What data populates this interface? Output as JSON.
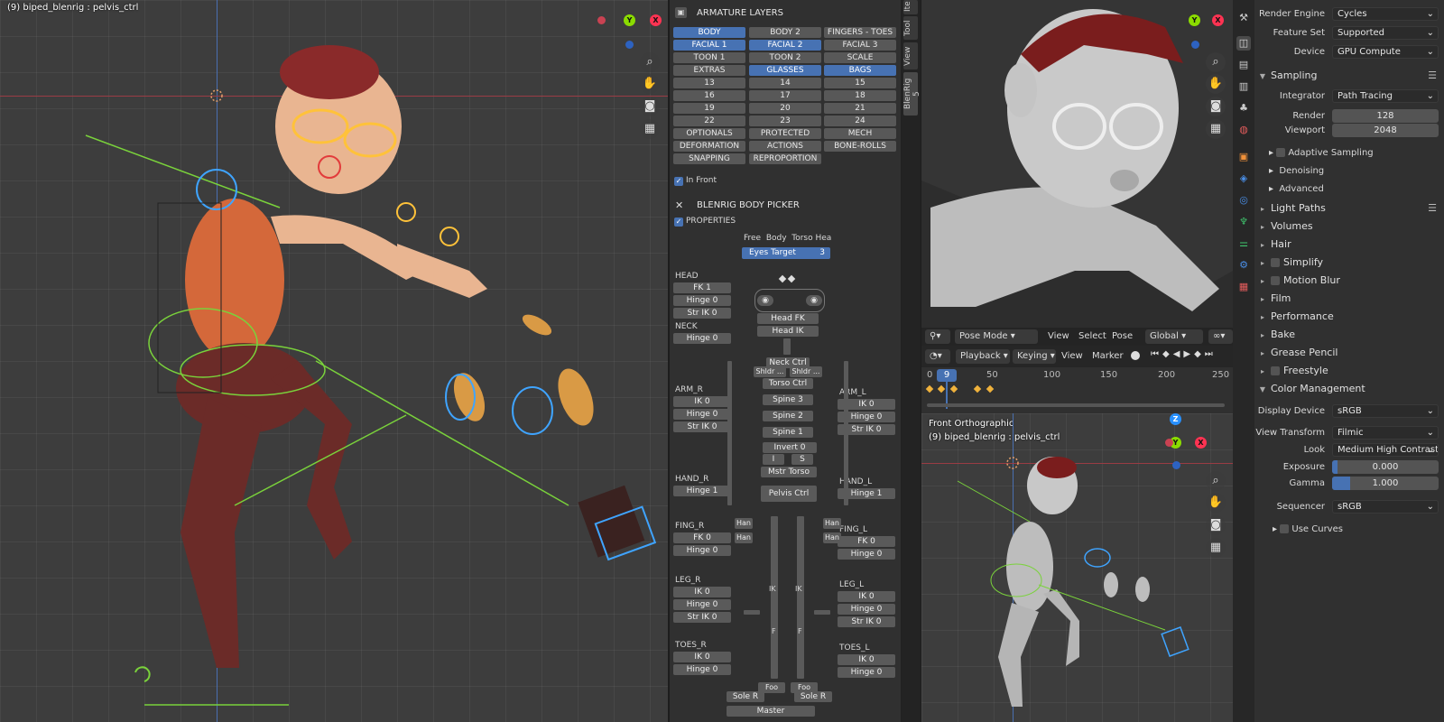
{
  "viewport_left": {
    "object_label": "(9) biped_blenrig : pelvis_ctrl",
    "axis": {
      "y": "Y",
      "x": "X"
    }
  },
  "armature_layers": {
    "title": "ARMATURE LAYERS",
    "rows": [
      [
        {
          "label": "BODY",
          "on": true
        },
        {
          "label": "BODY 2",
          "on": false
        },
        {
          "label": "FINGERS - TOES",
          "on": false
        }
      ],
      [
        {
          "label": "FACIAL 1",
          "on": true
        },
        {
          "label": "FACIAL 2",
          "on": true
        },
        {
          "label": "FACIAL 3",
          "on": false
        }
      ],
      [
        {
          "label": "TOON 1",
          "on": false
        },
        {
          "label": "TOON 2",
          "on": false
        },
        {
          "label": "SCALE",
          "on": false
        }
      ],
      [
        {
          "label": "EXTRAS",
          "on": false
        },
        {
          "label": "GLASSES",
          "on": true
        },
        {
          "label": "BAGS",
          "on": true
        }
      ],
      [
        {
          "label": "13",
          "on": false
        },
        {
          "label": "14",
          "on": false
        },
        {
          "label": "15",
          "on": false
        }
      ],
      [
        {
          "label": "16",
          "on": false
        },
        {
          "label": "17",
          "on": false
        },
        {
          "label": "18",
          "on": false
        }
      ],
      [
        {
          "label": "19",
          "on": false
        },
        {
          "label": "20",
          "on": false
        },
        {
          "label": "21",
          "on": false
        }
      ],
      [
        {
          "label": "22",
          "on": false
        },
        {
          "label": "23",
          "on": false
        },
        {
          "label": "24",
          "on": false
        }
      ],
      [
        {
          "label": "OPTIONALS",
          "on": false
        },
        {
          "label": "PROTECTED",
          "on": false
        },
        {
          "label": "MECH",
          "on": false
        }
      ],
      [
        {
          "label": "DEFORMATION",
          "on": false
        },
        {
          "label": "ACTIONS",
          "on": false
        },
        {
          "label": "BONE-ROLLS",
          "on": false
        }
      ],
      [
        {
          "label": "SNAPPING",
          "on": false
        },
        {
          "label": "REPROPORTION",
          "on": false
        }
      ]
    ],
    "in_front": "In Front"
  },
  "body_picker": {
    "title": "BLENRIG BODY PICKER",
    "properties": "PROPERTIES",
    "tabs": "Free  Body  Torso Hea",
    "eyes_target": "Eyes Target",
    "eyes_target_value": "3",
    "left": [
      {
        "group": "HEAD",
        "buttons": [
          "FK 1",
          "Hinge 0",
          "Str IK 0"
        ]
      },
      {
        "group": "NECK",
        "buttons": [
          "Hinge 0"
        ]
      },
      {
        "group": "ARM_R",
        "buttons": [
          "IK 0",
          "Hinge 0",
          "Str IK 0"
        ]
      },
      {
        "group": "HAND_R",
        "buttons": [
          "Hinge 1"
        ]
      },
      {
        "group": "FING_R",
        "buttons": [
          "FK 0",
          "Hinge 0"
        ]
      },
      {
        "group": "LEG_R",
        "buttons": [
          "IK 0",
          "Hinge 0",
          "Str IK 0"
        ]
      },
      {
        "group": "TOES_R",
        "buttons": [
          "IK 0",
          "Hinge 0"
        ]
      }
    ],
    "right": [
      {
        "group": "ARM_L",
        "buttons": [
          "IK 0",
          "Hinge 0",
          "Str IK 0"
        ]
      },
      {
        "group": "HAND_L",
        "buttons": [
          "Hinge 1"
        ]
      },
      {
        "group": "FING_L",
        "buttons": [
          "FK 0",
          "Hinge 0"
        ]
      },
      {
        "group": "LEG_L",
        "buttons": [
          "IK 0",
          "Hinge 0",
          "Str IK 0"
        ]
      },
      {
        "group": "TOES_L",
        "buttons": [
          "IK 0",
          "Hinge 0"
        ]
      }
    ],
    "center": {
      "head_fk": "Head FK",
      "head_ik": "Head IK",
      "neck_ctrl": "Neck Ctrl",
      "shldr_l": "Shldr ...",
      "shldr_r": "Shldr ...",
      "torso_ctrl": "Torso Ctrl",
      "spine3": "Spine 3",
      "spine2": "Spine 2",
      "spine1": "Spine 1",
      "invert": "Invert 0",
      "i": "I",
      "s": "S",
      "mstr_torso": "Mstr Torso",
      "pelvis_ctrl": "Pelvis Ctrl",
      "han1": "Han",
      "han2": "Han",
      "han3": "Han",
      "han4": "Han",
      "ik": "IK",
      "f": "F",
      "foo1": "Foo",
      "foo2": "Foo",
      "sole_r": "Sole R",
      "sole_l": "Sole R",
      "master": "Master"
    }
  },
  "side_tabs": [
    "Ite",
    "Tool",
    "View",
    "BlenRig 5"
  ],
  "viewport_persp": {
    "header": {
      "mode": "Pose Mode",
      "menus": [
        "View",
        "Select",
        "Pose"
      ],
      "orientation": "Global"
    },
    "axis": {
      "y": "Y",
      "x": "X"
    }
  },
  "timeline": {
    "menus": [
      "Playback",
      "Keying",
      "View",
      "Marker"
    ],
    "current_frame": "9",
    "ticks": [
      "0",
      "50",
      "100",
      "150",
      "200",
      "250"
    ]
  },
  "viewport_front": {
    "title": "Front Orthographic",
    "object_label": "(9) biped_blenrig : pelvis_ctrl",
    "axis": {
      "z": "Z",
      "y": "Y",
      "x": "X"
    }
  },
  "properties": {
    "render_engine_label": "Render Engine",
    "render_engine": "Cycles",
    "feature_set_label": "Feature Set",
    "feature_set": "Supported",
    "device_label": "Device",
    "device": "GPU Compute",
    "sampling": "Sampling",
    "integrator_label": "Integrator",
    "integrator": "Path Tracing",
    "render_label": "Render",
    "render": "128",
    "viewport_label": "Viewport",
    "viewport": "2048",
    "adaptive": "Adaptive Sampling",
    "denoising": "Denoising",
    "advanced": "Advanced",
    "sections": [
      "Light Paths",
      "Volumes",
      "Hair",
      "Simplify",
      "Motion Blur",
      "Film",
      "Performance",
      "Bake",
      "Grease Pencil",
      "Freestyle"
    ],
    "color_management": "Color Management",
    "display_device_label": "Display Device",
    "display_device": "sRGB",
    "view_transform_label": "View Transform",
    "view_transform": "Filmic",
    "look_label": "Look",
    "look": "Medium High Contrast",
    "exposure_label": "Exposure",
    "exposure": "0.000",
    "gamma_label": "Gamma",
    "gamma": "1.000",
    "sequencer_label": "Sequencer",
    "sequencer": "sRGB",
    "use_curves": "Use Curves"
  }
}
